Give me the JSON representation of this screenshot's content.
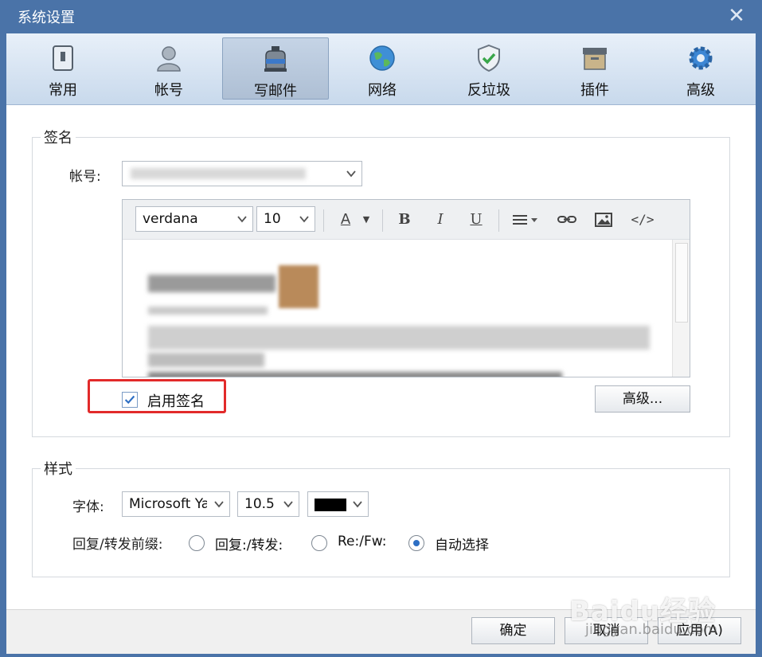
{
  "window": {
    "title": "系统设置",
    "close_icon": "close-icon"
  },
  "toolbar": {
    "items": [
      {
        "label": "常用",
        "icon": "general-icon",
        "active": false
      },
      {
        "label": "帐号",
        "icon": "account-icon",
        "active": false
      },
      {
        "label": "写邮件",
        "icon": "compose-icon",
        "active": true
      },
      {
        "label": "网络",
        "icon": "globe-icon",
        "active": false
      },
      {
        "label": "反垃圾",
        "icon": "shield-icon",
        "active": false
      },
      {
        "label": "插件",
        "icon": "plugin-icon",
        "active": false
      },
      {
        "label": "高级",
        "icon": "gear-icon",
        "active": false
      }
    ]
  },
  "signature": {
    "group_title": "签名",
    "account_label": "帐号:",
    "account_value": "",
    "editor": {
      "font_family": "verdana",
      "font_size": "10",
      "buttons": [
        "A",
        "B",
        "I",
        "U"
      ]
    },
    "enable_label": "启用签名",
    "enable_checked": true,
    "advanced_button": "高级..."
  },
  "style": {
    "group_title": "样式",
    "font_label": "字体:",
    "font_value": "Microsoft Ya",
    "size_value": "10.5",
    "color_value": "#000000",
    "prefix_label": "回复/转发前缀:",
    "prefix_options": [
      {
        "label": "回复:/转发:",
        "selected": false
      },
      {
        "label": "Re:/Fw:",
        "selected": false
      },
      {
        "label": "自动选择",
        "selected": true
      }
    ]
  },
  "footer": {
    "ok_label": "确定",
    "cancel_label": "取消",
    "apply_label": "应用(A)"
  },
  "watermark": {
    "text": "Baidu经验",
    "sub": "jingyan.baidu.com"
  },
  "colors": {
    "title_bar": "#4a73a8",
    "highlight": "#e22a2a",
    "accent": "#2d6fc4"
  }
}
